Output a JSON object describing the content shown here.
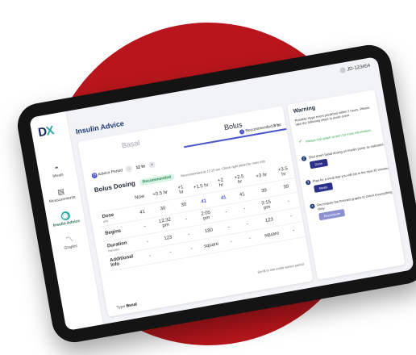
{
  "sidebar": {
    "items": [
      {
        "label": "Meals",
        "icon": "meal-icon"
      },
      {
        "label": "Measurements",
        "icon": "clipboard-icon"
      },
      {
        "label": "Insulin Advice",
        "icon": "insulin-icon",
        "active": true
      },
      {
        "label": "Graphs",
        "icon": "graph-icon"
      }
    ]
  },
  "header": {
    "user": "JD-123454",
    "page_title": "Insulin Advice"
  },
  "tabs": {
    "basal": "Basal",
    "bolus": "Bolus"
  },
  "recommended": {
    "text": "Recommended",
    "value": "8 hr"
  },
  "advice_period": {
    "label": "Advice Period",
    "minus": "-",
    "value": "12 hr",
    "plus": "+"
  },
  "bolus": {
    "title": "Bolus Dosing",
    "tag": "Recommended",
    "note": "Recommended at 12:15 am. Check right panel for more info"
  },
  "table": {
    "headers": [
      "Now",
      "+0.5 hr",
      "+1 hr",
      "+1.5 hr",
      "+2 hr",
      "+2.5 hr",
      "+3 hr",
      "+3.5 hr"
    ],
    "rows": {
      "dose": {
        "label": "Dose",
        "unit": "u/hr",
        "values": [
          "41",
          "30",
          "30",
          "41",
          "41",
          "41",
          "39",
          "39"
        ]
      },
      "begins": {
        "label": "Begins",
        "values": [
          "-",
          "12:32 pm",
          "-",
          "2:05 pm",
          "-",
          "-",
          "3:15 pm",
          "-"
        ]
      },
      "duration": {
        "label": "Duration",
        "unit": "minutes",
        "values": [
          "-",
          "123",
          "-",
          "180",
          "-",
          "-",
          "123",
          "-"
        ]
      },
      "info": {
        "label": "Additional Info",
        "values": [
          "-",
          "-",
          "-",
          "square",
          "-",
          "-",
          "square",
          "-"
        ]
      }
    }
  },
  "scroll_hint": "Scroll to see entire advice period",
  "type_line": {
    "label": "Type",
    "value": "Basal"
  },
  "warning": {
    "title": "Warning",
    "text": "Possible Hypo event predicted within 2 hours. Please take the following steps to avoid event.",
    "steps": [
      {
        "text": "Please visit graph screen for more information.",
        "done": true
      },
      {
        "text": "Shut down basal dosing on insulin pump as indicated.",
        "button": "Done"
      },
      {
        "text": "Plan for a meal that you will eat in the next 30 minutes.",
        "button": "Meals"
      },
      {
        "text": "Recompute the forecast graphs to check if everything is okay.",
        "button": "Recompute"
      }
    ]
  }
}
